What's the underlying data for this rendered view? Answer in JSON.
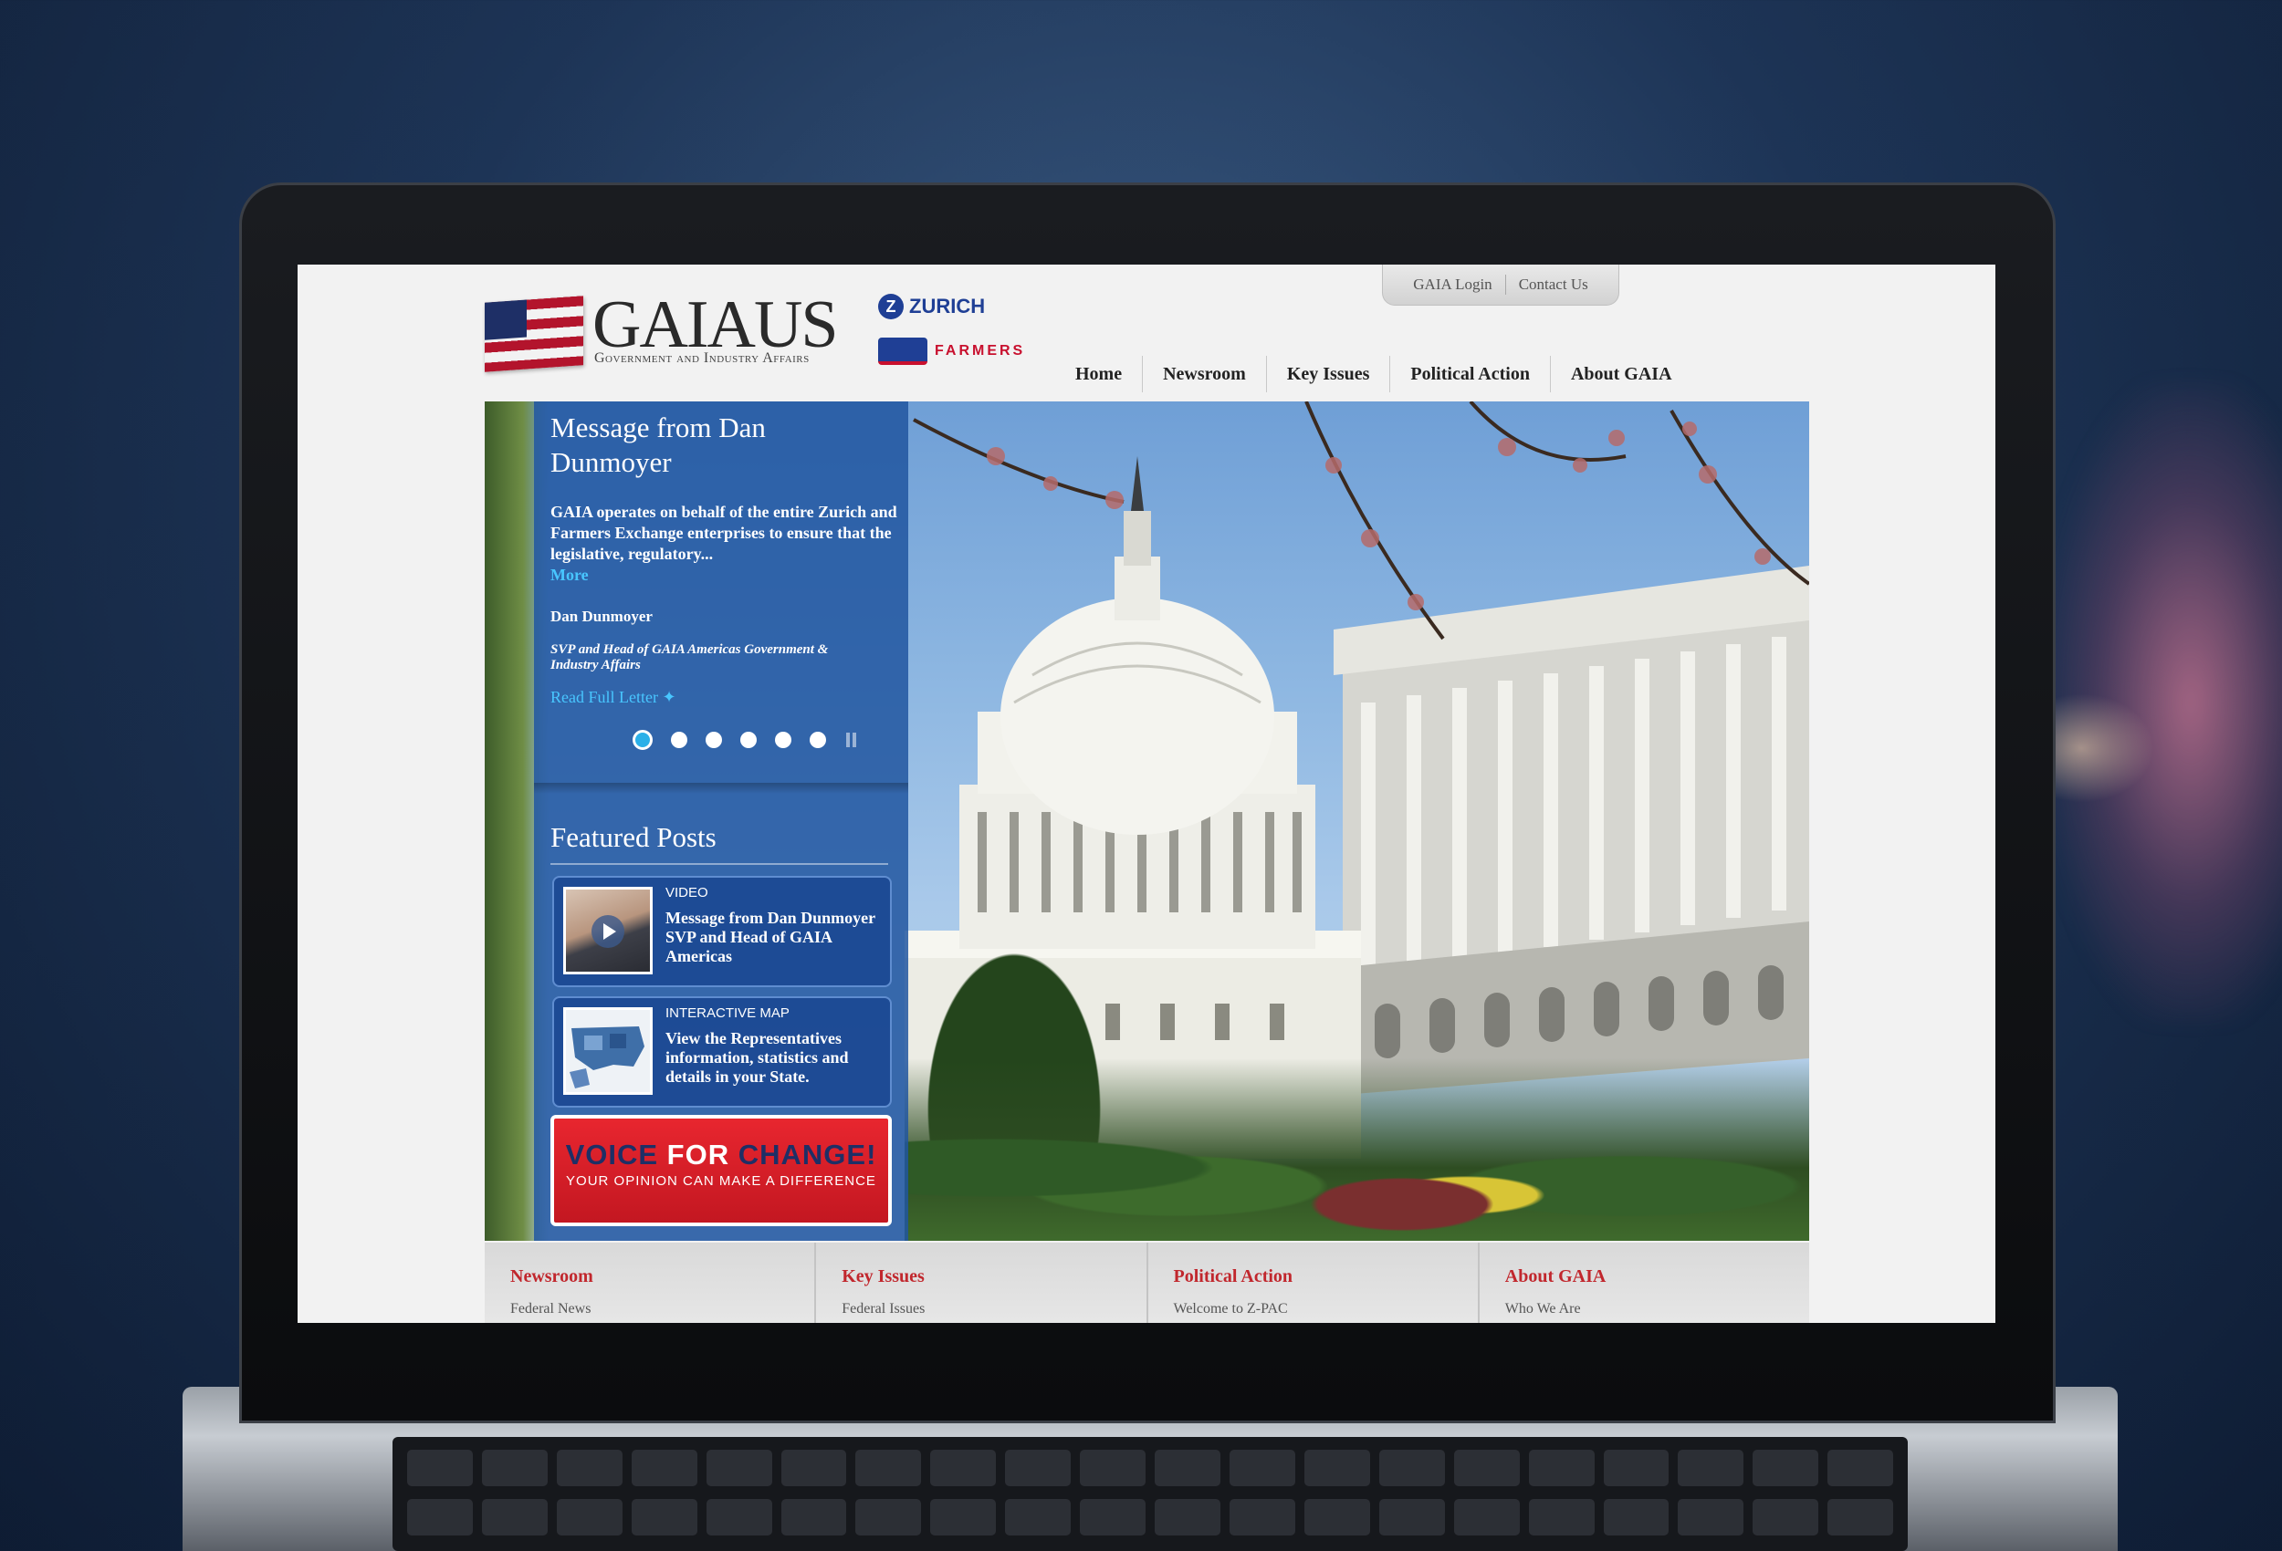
{
  "site": {
    "logo_text": "GAIAUS",
    "logo_subtitle": "Government and Industry Affairs",
    "partner_zurich": "ZURICH",
    "partner_farmers": "FARMERS"
  },
  "utility_nav": {
    "login": "GAIA Login",
    "contact": "Contact Us"
  },
  "main_nav": [
    "Home",
    "Newsroom",
    "Key Issues",
    "Political Action",
    "About GAIA"
  ],
  "hero": {
    "title": "Message from Dan Dunmoyer",
    "body": "GAIA operates on behalf of the entire Zurich and Farmers Exchange enterprises to ensure that the legislative, regulatory...",
    "more": "More",
    "author_name": "Dan Dunmoyer",
    "author_role": "SVP and Head of GAIA Americas Government & Industry Affairs",
    "read_full": "Read Full Letter",
    "slides_total": 6,
    "active_slide": 1
  },
  "featured": {
    "title": "Featured Posts",
    "posts": [
      {
        "kind": "VIDEO",
        "text": "Message from Dan Dunmoyer SVP and Head of GAIA Americas"
      },
      {
        "kind": "INTERACTIVE MAP",
        "text": "View the Representatives information, statistics and details in your State."
      }
    ]
  },
  "voice_banner": {
    "word1": "VOICE ",
    "word2": "FOR ",
    "word3": "CHANGE!",
    "subtitle": "YOUR OPINION CAN MAKE A DIFFERENCE"
  },
  "footer": {
    "columns": [
      {
        "heading": "Newsroom",
        "first_item": "Federal News"
      },
      {
        "heading": "Key Issues",
        "first_item": "Federal Issues"
      },
      {
        "heading": "Political Action",
        "first_item": "Welcome to Z-PAC"
      },
      {
        "heading": "About GAIA",
        "first_item": "Who We Are"
      }
    ]
  },
  "colors": {
    "panel_blue": "#2156a0",
    "link_cyan": "#48c6ff",
    "footer_red": "#c1272d",
    "banner_red": "#e8262f"
  }
}
